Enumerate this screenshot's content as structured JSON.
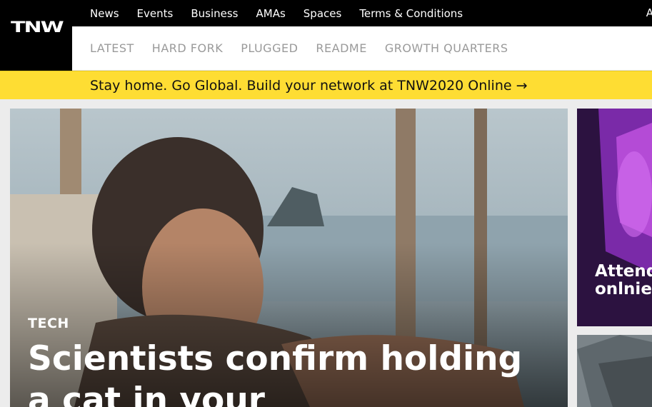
{
  "top_nav": {
    "items": [
      "News",
      "Events",
      "Business",
      "AMAs",
      "Spaces",
      "Terms & Conditions"
    ],
    "right_fragment": "A"
  },
  "logo": {
    "text": "TNW"
  },
  "sub_nav": {
    "items": [
      "LATEST",
      "HARD FORK",
      "PLUGGED",
      "README",
      "GROWTH QUARTERS"
    ]
  },
  "promo": {
    "text": "Stay home. Go Global. Build your network at TNW2020 Online →",
    "background": "#fedd33"
  },
  "hero": {
    "category": "TECH",
    "headline": "Scientists confirm holding a cat in your"
  },
  "side_cards": [
    {
      "title": "Attend our annual onlnie"
    }
  ],
  "colors": {
    "topbar": "#000000",
    "promo": "#fedd33",
    "nav_text_muted": "#9a9a9a"
  }
}
